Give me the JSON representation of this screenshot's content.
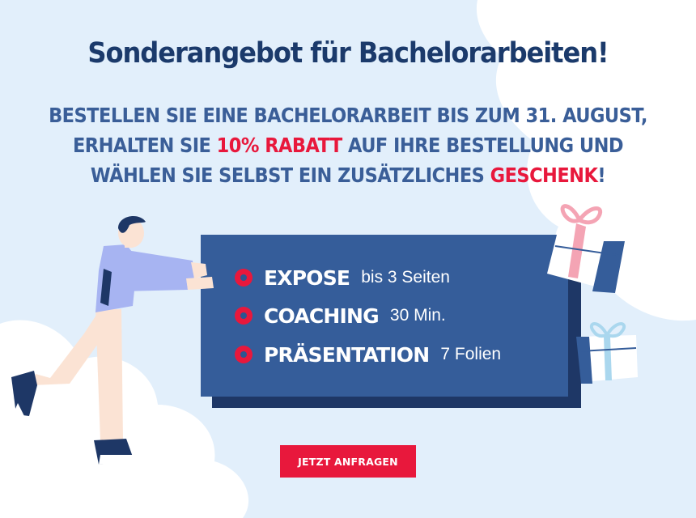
{
  "headline": "Sonderangebot für Bachelorarbeiten!",
  "subheadline": {
    "line1": "BESTELLEN SIE EINE BACHELORARBEIT BIS ZUM 31. AUGUST,",
    "line2_start": "ERHALTEN SIE ",
    "line2_highlight": "10% RABATT",
    "line2_end": " AUF IHRE BESTELLUNG UND",
    "line3_start": "WÄHLEN SIE SELBST EIN ZUSÄTZLICHES ",
    "line3_highlight": "GESCHENK",
    "line3_end": "!"
  },
  "offers": [
    {
      "name": "EXPOSE",
      "detail": "bis 3 Seiten",
      "icon": "bullet-icon"
    },
    {
      "name": "COACHING",
      "detail": "30 Min.",
      "icon": "bullet-icon"
    },
    {
      "name": "PRÄSENTATION",
      "detail": "7 Folien",
      "icon": "bullet-icon"
    }
  ],
  "cta_label": "JETZT ANFRAGEN",
  "colors": {
    "background": "#e2effb",
    "heading": "#1b3a6b",
    "subheading": "#3a5e98",
    "accent": "#e8183c",
    "card": "#355d9a",
    "card_shadow": "#1e3766"
  },
  "illustrations": [
    "person-pushing-board-illustration",
    "large-gift-icon",
    "small-gift-icon"
  ]
}
